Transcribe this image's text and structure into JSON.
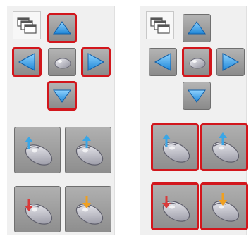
{
  "colors": {
    "panel_bg": "#f0f0f0",
    "tile_bg": "#9c9c9c",
    "arrow_blue": "#3aa6e6",
    "highlight_red": "#d2161c",
    "mouse_body": "#d8d8e0",
    "indicator_orange": "#f0a020"
  },
  "panels": [
    {
      "name": "left",
      "highlighted": [
        "arrow-up",
        "arrow-left",
        "arrow-right",
        "arrow-down"
      ],
      "icons": {
        "windows_button": "window-stack-icon",
        "up": "arrow-up-icon",
        "left": "arrow-left-icon",
        "center": "mouse-icon",
        "right": "arrow-right-icon",
        "down": "arrow-down-icon",
        "big_buttons": [
          "mouse-scroll-up-left-icon",
          "mouse-scroll-up-right-icon",
          "mouse-scroll-down-left-icon",
          "mouse-scroll-down-right-icon"
        ]
      }
    },
    {
      "name": "right",
      "highlighted": [
        "mouse-center",
        "big-1",
        "big-2",
        "big-3",
        "big-4"
      ],
      "icons": {
        "windows_button": "window-stack-icon",
        "up": "arrow-up-icon",
        "left": "arrow-left-icon",
        "center": "mouse-icon",
        "right": "arrow-right-icon",
        "down": "arrow-down-icon",
        "big_buttons": [
          "mouse-scroll-up-left-icon",
          "mouse-scroll-up-right-icon",
          "mouse-scroll-down-left-icon",
          "mouse-scroll-down-right-icon"
        ]
      }
    }
  ]
}
